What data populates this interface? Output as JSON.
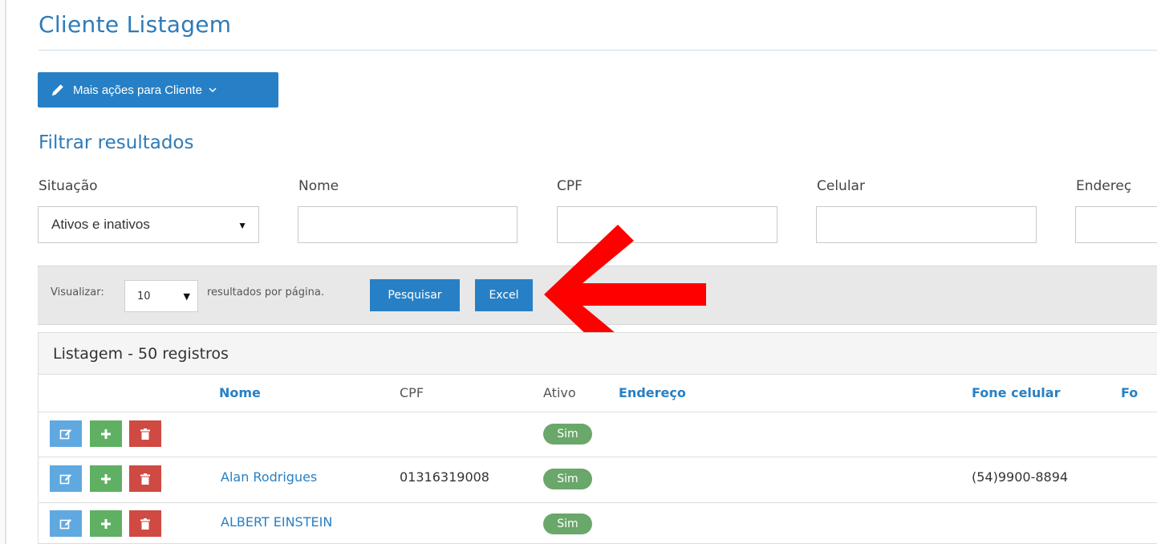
{
  "page": {
    "title": "Cliente Listagem"
  },
  "actions": {
    "more_actions_label": "Mais ações para Cliente",
    "icon": "pencil-icon"
  },
  "filters": {
    "title": "Filtrar resultados",
    "situacao": {
      "label": "Situação",
      "value": "Ativos e inativos"
    },
    "nome": {
      "label": "Nome",
      "value": ""
    },
    "cpf": {
      "label": "CPF",
      "value": ""
    },
    "celular": {
      "label": "Celular",
      "value": ""
    },
    "endereco": {
      "label": "Endereç",
      "value": ""
    }
  },
  "toolbar": {
    "view_label": "Visualizar:",
    "per_page_value": "10",
    "per_page_suffix": "resultados por página.",
    "search_label": "Pesquisar",
    "excel_label": "Excel"
  },
  "annotation": {
    "arrow_color": "#ff0000"
  },
  "listing": {
    "title": "Listagem - 50 registros",
    "columns": {
      "nome": "Nome",
      "cpf": "CPF",
      "ativo": "Ativo",
      "endereco": "Endereço",
      "fone_celular": "Fone celular",
      "fone_cut": "Fo"
    },
    "rows": [
      {
        "nome": "",
        "cpf": "",
        "ativo": "Sim",
        "endereco": "",
        "fone_celular": ""
      },
      {
        "nome": "Alan Rodrigues",
        "cpf": "01316319008",
        "ativo": "Sim",
        "endereco": "",
        "fone_celular": "(54)9900-8894"
      },
      {
        "nome": "ALBERT EINSTEIN",
        "cpf": "",
        "ativo": "Sim",
        "endereco": "",
        "fone_celular": ""
      }
    ]
  },
  "colors": {
    "primary": "#2780c6",
    "edit": "#5fa9e0",
    "add": "#5fb062",
    "delete": "#cf4a42",
    "badge": "#6aa76a"
  }
}
